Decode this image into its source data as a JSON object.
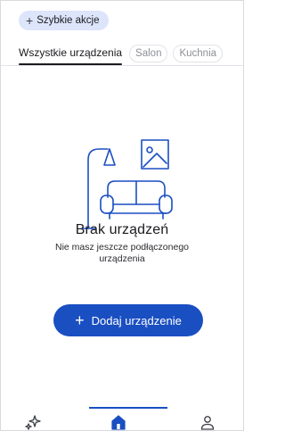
{
  "quick_actions": {
    "label": "Szybkie akcje",
    "icon": "plus-icon"
  },
  "tabs": [
    {
      "label": "Wszystkie urządzenia",
      "active": true
    },
    {
      "label": "Salon",
      "active": false
    },
    {
      "label": "Kuchnia",
      "active": false
    }
  ],
  "empty_state": {
    "title": "Brak urządzeń",
    "description": "Nie masz jeszcze podłączonego urządzenia",
    "illustration": "living-room-illustration"
  },
  "add_device": {
    "label": "Dodaj urządzenie",
    "icon": "plus-icon"
  },
  "bottom_nav": [
    {
      "icon": "sparkle-icon",
      "active": false
    },
    {
      "icon": "home-icon",
      "active": true
    },
    {
      "icon": "profile-icon",
      "active": false
    }
  ],
  "colors": {
    "accent": "#1a4fc2",
    "chip_background": "#dde5fb",
    "illustration_stroke": "#1a4fc2"
  }
}
